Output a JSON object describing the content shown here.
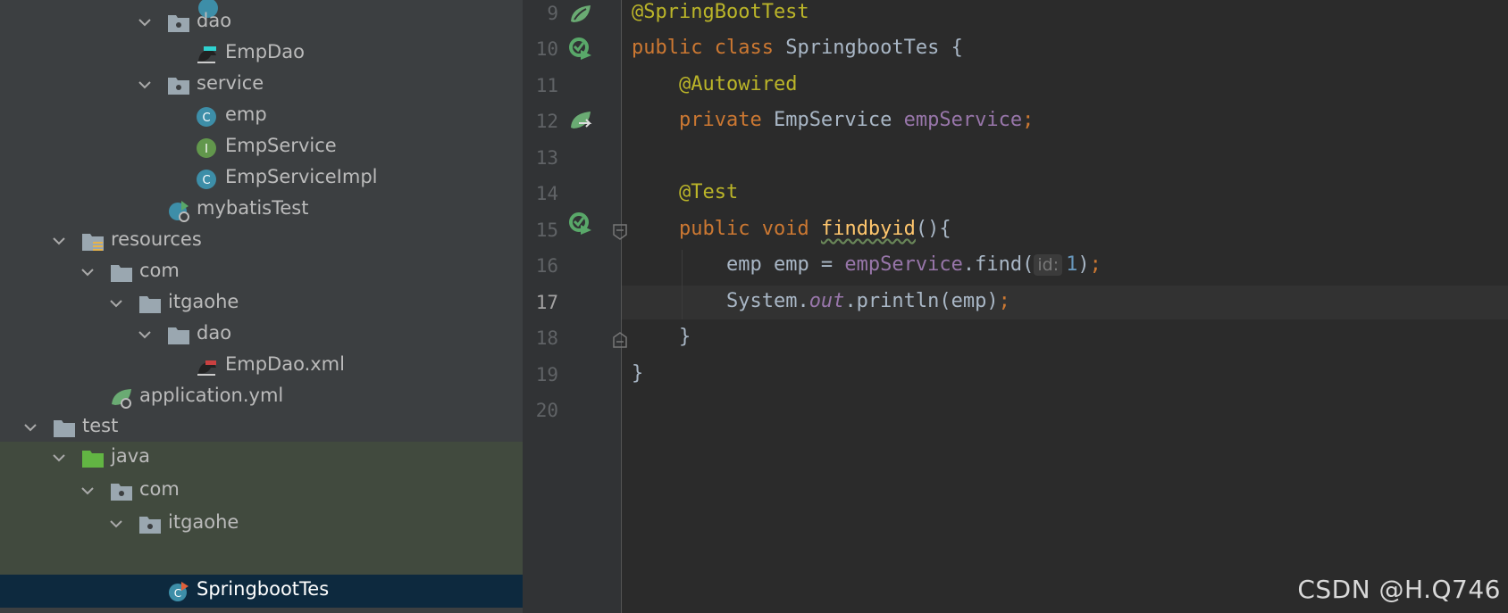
{
  "project_tree": {
    "items": [
      {
        "label": "dao",
        "icon": "package-folder-icon",
        "expanded": true
      },
      {
        "label": "EmpDao",
        "icon": "mybatis-mapper-icon"
      },
      {
        "label": "service",
        "icon": "package-folder-icon",
        "expanded": true
      },
      {
        "label": "emp",
        "icon": "class-icon"
      },
      {
        "label": "EmpService",
        "icon": "interface-icon"
      },
      {
        "label": "EmpServiceImpl",
        "icon": "class-icon"
      },
      {
        "label": "mybatisTest",
        "icon": "spring-boot-app-icon"
      },
      {
        "label": "resources",
        "icon": "resources-folder-icon",
        "expanded": true
      },
      {
        "label": "com",
        "icon": "folder-icon",
        "expanded": true
      },
      {
        "label": "itgaohe",
        "icon": "folder-icon",
        "expanded": true
      },
      {
        "label": "dao",
        "icon": "folder-icon",
        "expanded": true
      },
      {
        "label": "EmpDao.xml",
        "icon": "mybatis-xml-icon"
      },
      {
        "label": "application.yml",
        "icon": "spring-config-icon"
      },
      {
        "label": "test",
        "icon": "folder-icon",
        "expanded": true
      },
      {
        "label": "java",
        "icon": "test-source-folder-icon",
        "expanded": true
      },
      {
        "label": "com",
        "icon": "package-folder-icon",
        "expanded": true
      },
      {
        "label": "itgaohe",
        "icon": "package-folder-icon",
        "expanded": true
      },
      {
        "label": "SpringbootTes",
        "icon": "test-class-icon",
        "selected": true
      }
    ]
  },
  "editor": {
    "line_numbers": [
      "9",
      "10",
      "11",
      "12",
      "13",
      "14",
      "15",
      "16",
      "17",
      "18",
      "19",
      "20"
    ],
    "current_line": "17",
    "code": {
      "l9_annotation": "@SpringBootTest",
      "l10_public": "public",
      "l10_class": "class",
      "l10_name": "SpringbootTes",
      "l10_brace": "{",
      "l11_annotation": "@Autowired",
      "l12_private": "private",
      "l12_type": "EmpService",
      "l12_field": "empService",
      "l12_semi": ";",
      "l14_annotation": "@Test",
      "l15_public": "public",
      "l15_void": "void",
      "l15_method": "findbyid",
      "l15_rest": "(){",
      "l16_decl": "emp emp = ",
      "l16_field": "empService",
      "l16_call": ".find(",
      "l16_hint": "id:",
      "l16_arg": "1",
      "l16_close": ")",
      "l16_semi": ";",
      "l17_sys": "System.",
      "l17_out": "out",
      "l17_call": ".println(emp)",
      "l17_semi": ";",
      "l18_brace": "}",
      "l19_brace": "}"
    }
  },
  "watermark": "CSDN @H.Q746",
  "colors": {
    "keyword": "#cc7832",
    "annotation": "#bbb529",
    "field": "#9876aa",
    "method": "#ffc66d",
    "number": "#6897bb",
    "text": "#a9b7c6",
    "selection": "#0d293e",
    "test_highlight": "#414a3e",
    "spring_green": "#6aab73"
  }
}
